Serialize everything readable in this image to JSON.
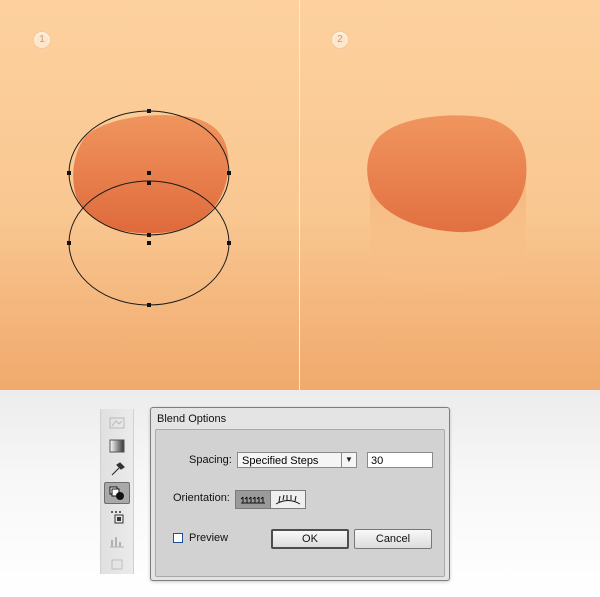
{
  "panels": {
    "left": {
      "step": "1"
    },
    "right": {
      "step": "2"
    }
  },
  "toolbar": {
    "tools": [
      "symbol-sprayer-tool-icon",
      "gradient-tool-icon",
      "eyedropper-tool-icon",
      "blend-tool-icon",
      "symbol-tool-icon",
      "graph-tool-icon",
      "artboard-tool-icon"
    ],
    "active_tool": "blend-tool-icon"
  },
  "dialog": {
    "title": "Blend Options",
    "spacing_label": "Spacing:",
    "spacing_value": "Specified Steps",
    "steps_value": "30",
    "orientation_label": "Orientation:",
    "preview_label": "Preview",
    "preview_checked": false,
    "ok_label": "OK",
    "cancel_label": "Cancel"
  },
  "colors": {
    "background_top": "#fdd19e",
    "background_bottom": "#f0a96c",
    "shape_fill": "#e8794a",
    "accent_checkbox": "#1d4f9c"
  }
}
